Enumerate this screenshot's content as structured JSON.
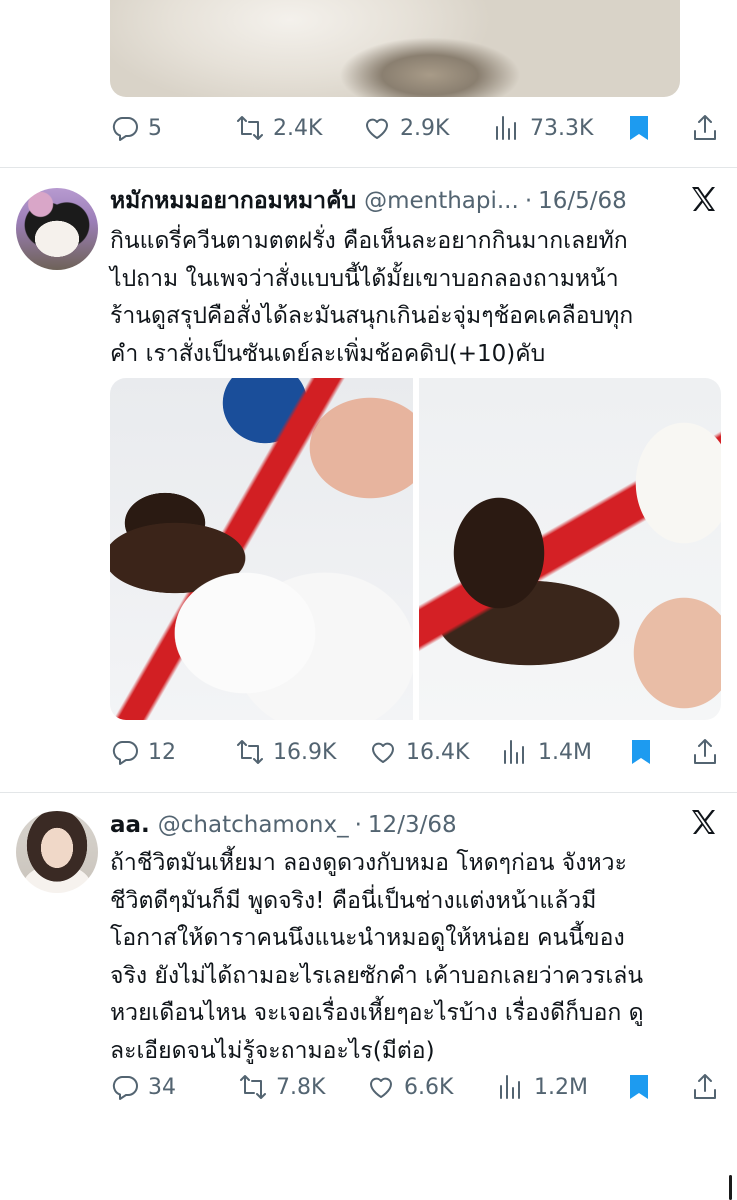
{
  "tweets": [
    {
      "stats": {
        "replies": "5",
        "retweets": "2.4K",
        "likes": "2.9K",
        "views": "73.3K"
      },
      "bookmarked": true
    },
    {
      "display_name": "หมักหมมอยากอมหมาคับ",
      "handle": "@menthapi...",
      "separator": "·",
      "date": "16/5/68",
      "text_lines": [
        "กินแดรี่ควีนตามตตฝรั่ง คือเห็นละอยากกินมากเลยทัก",
        "ไปถาม ในเพจว่าสั่งแบบนี้ได้มั้ยเขาบอกลองถามหน้า",
        "ร้านดูสรุปคือสั่งได้ละมันสนุกเกินอ่ะจุ่มๆช้อคเคลือบทุก",
        "คำ เราสั่งเป็นซันเดย์ละเพิ่มช้อคดิป(+10)คับ"
      ],
      "stats": {
        "replies": "12",
        "retweets": "16.9K",
        "likes": "16.4K",
        "views": "1.4M"
      },
      "bookmarked": true
    },
    {
      "display_name": "aa.",
      "handle": "@chatchamonx_",
      "separator": "·",
      "date": "12/3/68",
      "text_lines": [
        "ถ้าชีวิตมันเหี้ยมา ลองดูดวงกับหมอ โหดๆก่อน จังหวะ",
        "ชีวิตดีๆมันก็มี พูดจริง! คือนี่เป็นช่างแต่งหน้าแล้วมี",
        "โอกาสให้ดาราคนนึงแนะนำหมอดูให้หน่อย คนนี้ของ",
        "จริง ยังไม่ได้ถามอะไรเลยซักคำ เค้าบอกเลยว่าควรเล่น",
        "หวยเดือนไหน จะเจอเรื่องเหี้ยๆอะไรบ้าง เรื่องดีก็บอก ดู",
        "ละเอียดจนไม่รู้จะถามอะไร(มีต่อ)"
      ],
      "stats": {
        "replies": "34",
        "retweets": "7.8K",
        "likes": "6.6K",
        "views": "1.2M"
      },
      "bookmarked": true
    }
  ],
  "icons": {
    "reply": "reply-icon",
    "retweet": "retweet-icon",
    "like": "heart-icon",
    "views": "views-icon",
    "bookmark": "bookmark-icon",
    "share": "share-icon",
    "grok": "x-logo-icon"
  },
  "colors": {
    "accent": "#1d9bf0",
    "muted": "#536471",
    "text": "#0f1419",
    "divider": "#e3e6e8"
  }
}
